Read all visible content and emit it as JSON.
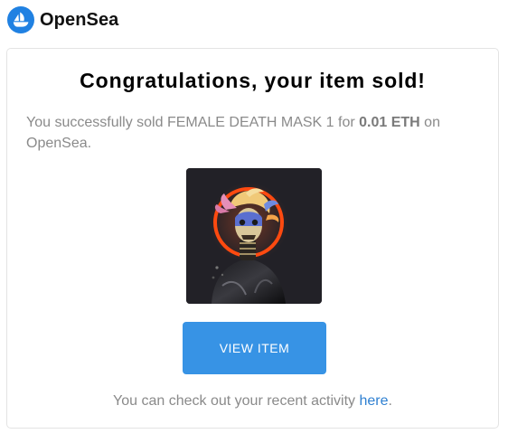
{
  "header": {
    "brand": "OpenSea",
    "logo_icon": "opensea-sailboat-icon",
    "logo_color": "#2081e2"
  },
  "email": {
    "title": "Congratulations, your item sold!",
    "message": {
      "prefix": "You successfully sold FEMALE DEATH MASK 1 for ",
      "price": "0.01 ETH",
      "suffix": " on OpenSea."
    },
    "nft_image": "female-death-mask-nft-image",
    "button_label": "VIEW ITEM",
    "footer": {
      "prefix": "You can check out your recent activity ",
      "link": "here",
      "suffix": "."
    }
  },
  "colors": {
    "button": "#3793e5",
    "link": "#2f80d1",
    "body_text": "#8a8a8a"
  }
}
